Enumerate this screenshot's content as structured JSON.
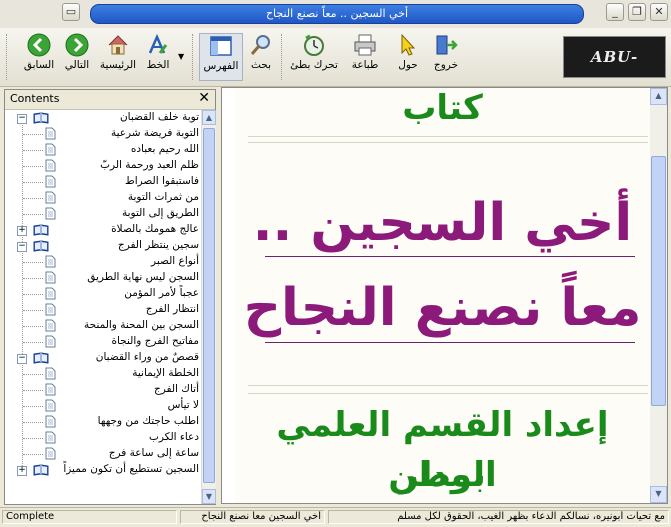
{
  "window": {
    "title": "أخي السجين .. معاً نصنع النجاح",
    "min_label": "_",
    "restore_label": "❐",
    "close_label": "✕",
    "sys_label": "▭"
  },
  "toolbar": {
    "back_label": "السابق",
    "forward_label": "التالي",
    "home_label": "الرئيسية",
    "font_label": "الخط",
    "index_label": "الفهرس",
    "search_label": "بحث",
    "slow_move_label": "تحرك بطئ",
    "print_label": "طباعة",
    "about_label": "حول",
    "exit_label": "خروج",
    "logo_text": "ABU-MERA"
  },
  "contents_pane": {
    "title": "Contents",
    "close_label": "✕",
    "items": [
      {
        "label": "توبة خلف القضبان",
        "level": 0,
        "type": "book",
        "expanded": true
      },
      {
        "label": "التوبة فريضة شرعية",
        "level": 1,
        "type": "page"
      },
      {
        "label": "الله رحيم بعباده",
        "level": 1,
        "type": "page"
      },
      {
        "label": "ظلم العبد ورحمة الربّ",
        "level": 1,
        "type": "page"
      },
      {
        "label": "فاستبقوا الصراط",
        "level": 1,
        "type": "page"
      },
      {
        "label": "من ثمرات التوبة",
        "level": 1,
        "type": "page"
      },
      {
        "label": "الطريق إلى التوبة",
        "level": 1,
        "type": "page"
      },
      {
        "label": "عالج همومك بالصلاة",
        "level": 0,
        "type": "book",
        "expanded": false
      },
      {
        "label": "سجين ينتظر الفرج",
        "level": 0,
        "type": "book",
        "expanded": true
      },
      {
        "label": "أنواع الصبر",
        "level": 1,
        "type": "page"
      },
      {
        "label": "السجن ليس نهاية الطريق",
        "level": 1,
        "type": "page"
      },
      {
        "label": "عجباً لأمر المؤمن",
        "level": 1,
        "type": "page"
      },
      {
        "label": "انتظار الفرج",
        "level": 1,
        "type": "page"
      },
      {
        "label": "السجن بين المحنة والمنحة",
        "level": 1,
        "type": "page"
      },
      {
        "label": "مفاتيح الفرج والنجاة",
        "level": 1,
        "type": "page"
      },
      {
        "label": "قصصٌ من وراء القضبان",
        "level": 0,
        "type": "book",
        "expanded": true
      },
      {
        "label": "الخلطة الإيمانية",
        "level": 1,
        "type": "page"
      },
      {
        "label": "أتاك الفرج",
        "level": 1,
        "type": "page"
      },
      {
        "label": "لا تيأس",
        "level": 1,
        "type": "page"
      },
      {
        "label": "اطلب حاجتك من وجهها",
        "level": 1,
        "type": "page"
      },
      {
        "label": "دعاء الكرب",
        "level": 1,
        "type": "page"
      },
      {
        "label": "ساعة إلى ساعة فرج",
        "level": 1,
        "type": "page"
      },
      {
        "label": "السجين تستطيع أن تكون مميزاً",
        "level": 0,
        "type": "book",
        "expanded": false
      }
    ]
  },
  "content": {
    "kitab": "كتاب",
    "title_line1": "أخي السجين ..",
    "title_line2": "معاً نصنع النجاح",
    "prepared_line1": "إعداد القسم العلمي بمدار",
    "prepared_line2": "الوطن"
  },
  "status_bar": {
    "state": "Complete",
    "book_title": "أخي السجين معاً نصنع النجاح",
    "message": "مع تحيات أبونيره، نسألكم الدعاء بظهر الغيب، الحقوق لكل مسلم"
  },
  "colors": {
    "title_green": "#1a8a1a",
    "title_purple": "#8b1a7a",
    "titlebar_blue": "#2a66d4"
  }
}
